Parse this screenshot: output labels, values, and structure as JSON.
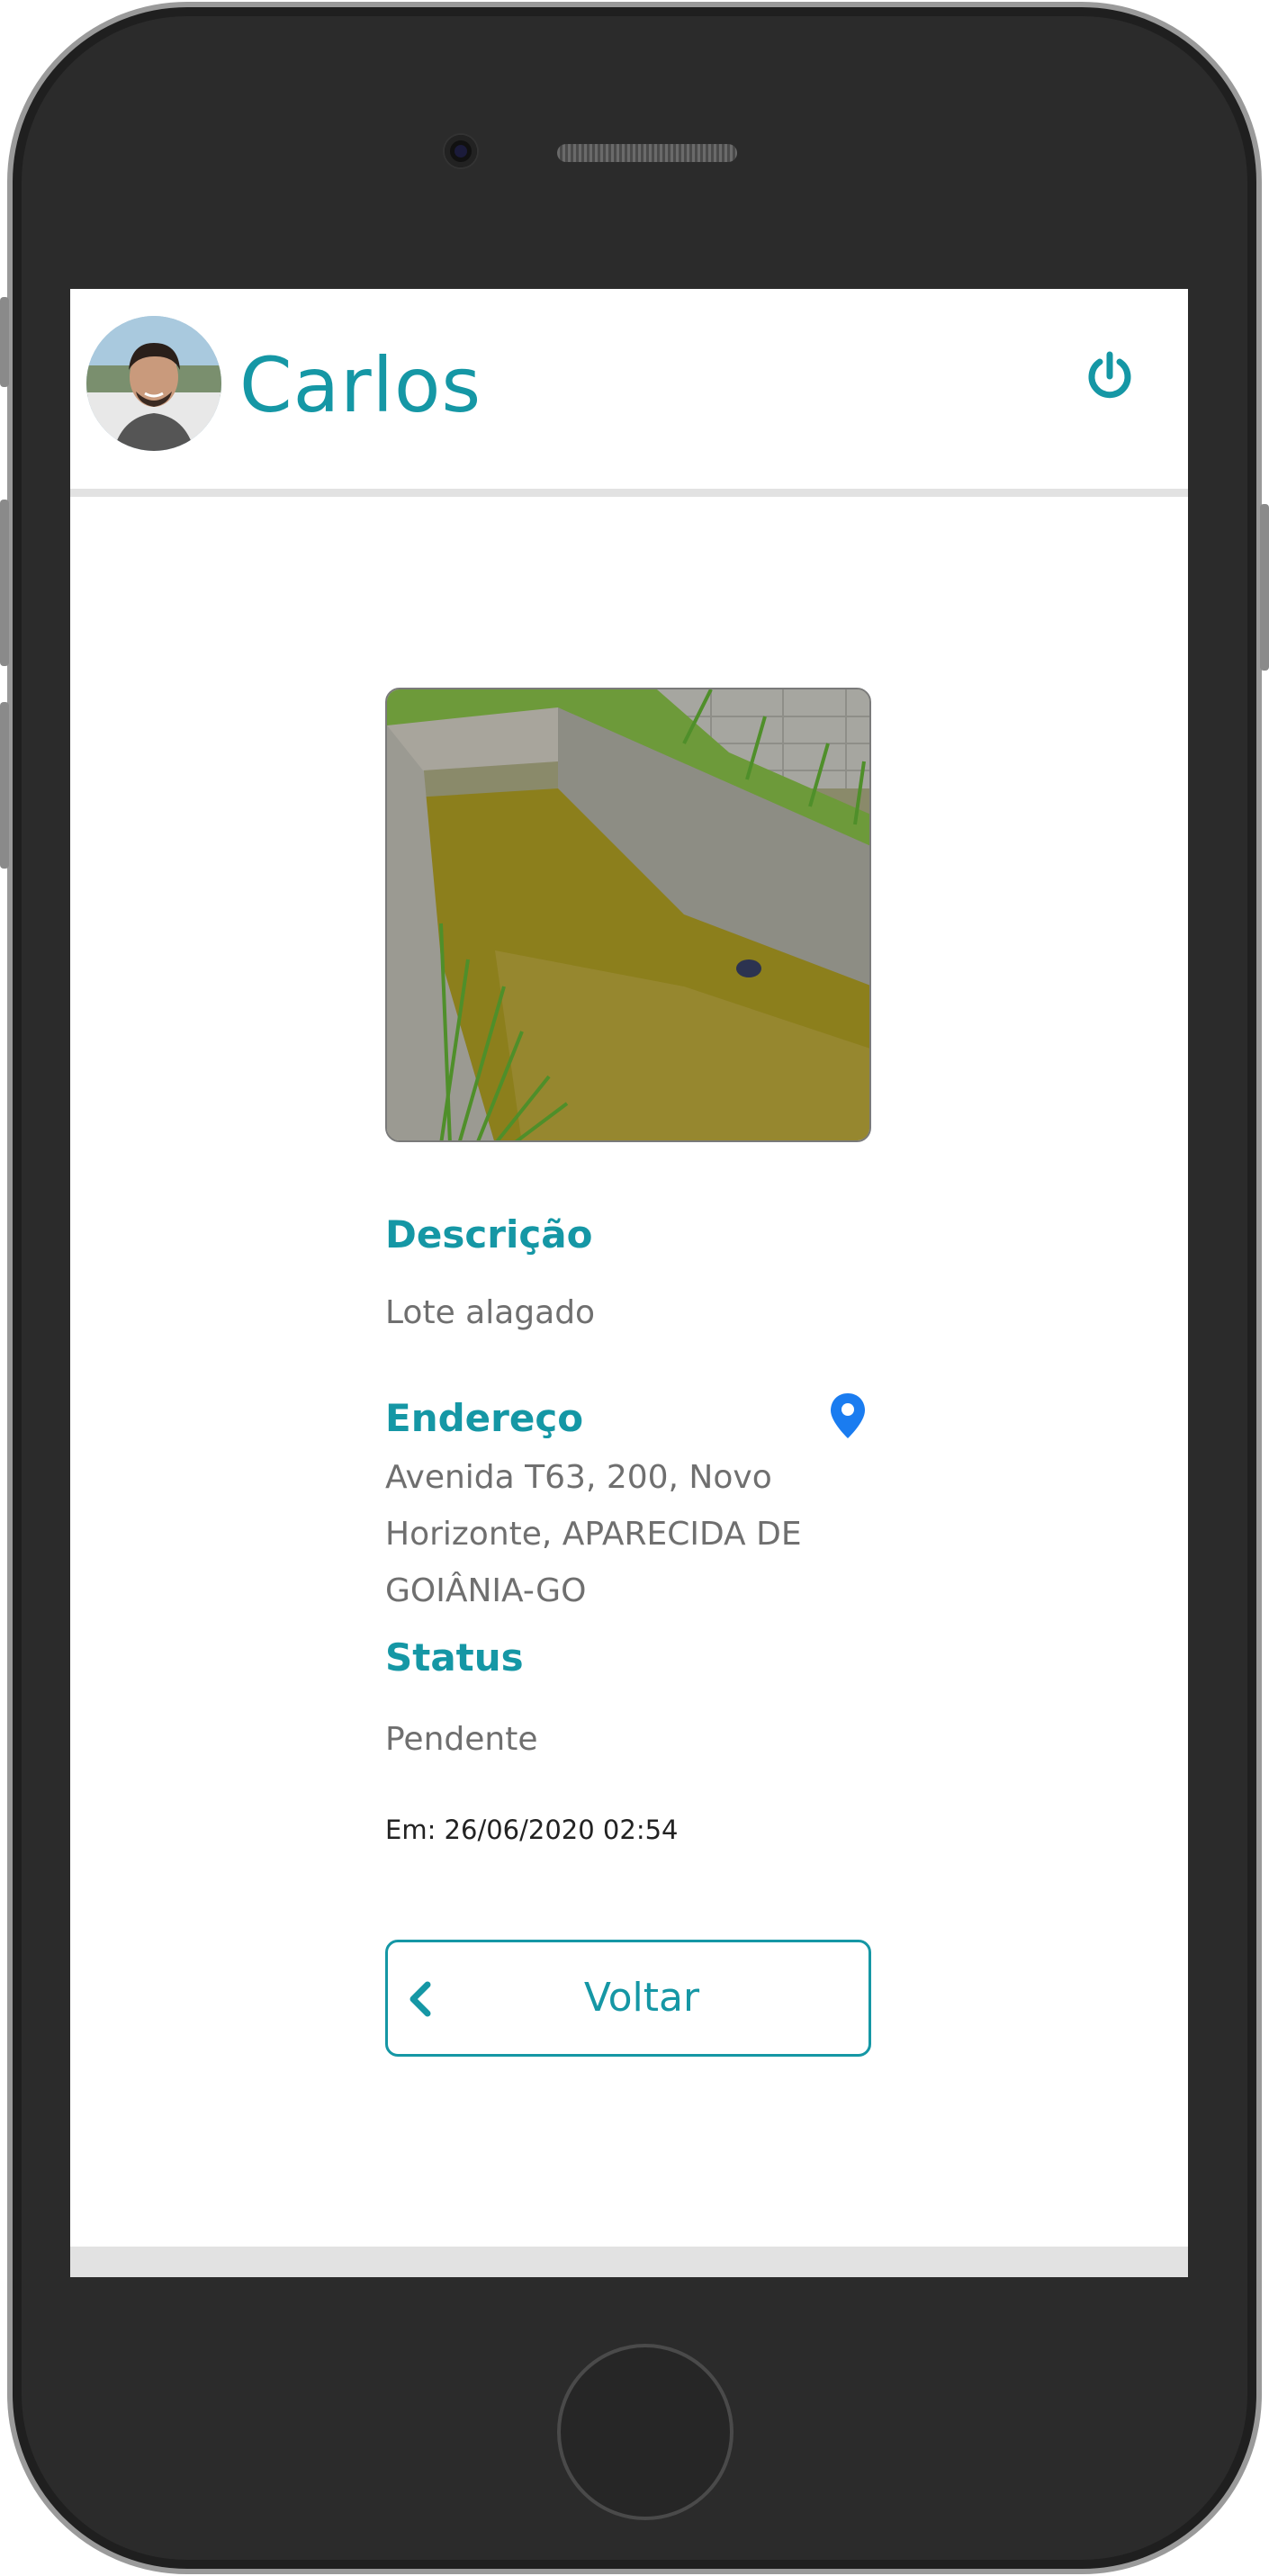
{
  "header": {
    "username": "Carlos",
    "avatar_icon": "user-avatar-photo",
    "logout_icon": "power-icon"
  },
  "report": {
    "photo_icon": "report-photo",
    "description_label": "Descrição",
    "description_value": "Lote alagado",
    "address_label": "Endereço",
    "address_line1": "Avenida T63, 200, Novo",
    "address_line2": "Horizonte, APARECIDA DE",
    "address_line3": "GOIÂNIA-GO",
    "map_icon": "map-pin-icon",
    "status_label": "Status",
    "status_value": "Pendente",
    "date_text": "Em: 26/06/2020 02:54"
  },
  "actions": {
    "back_label": "Voltar",
    "back_icon": "chevron-left-icon"
  },
  "colors": {
    "accent": "#1597a5",
    "pin": "#1a7cf0",
    "text_muted": "#6f6f6f",
    "divider": "#e2e2e2"
  }
}
